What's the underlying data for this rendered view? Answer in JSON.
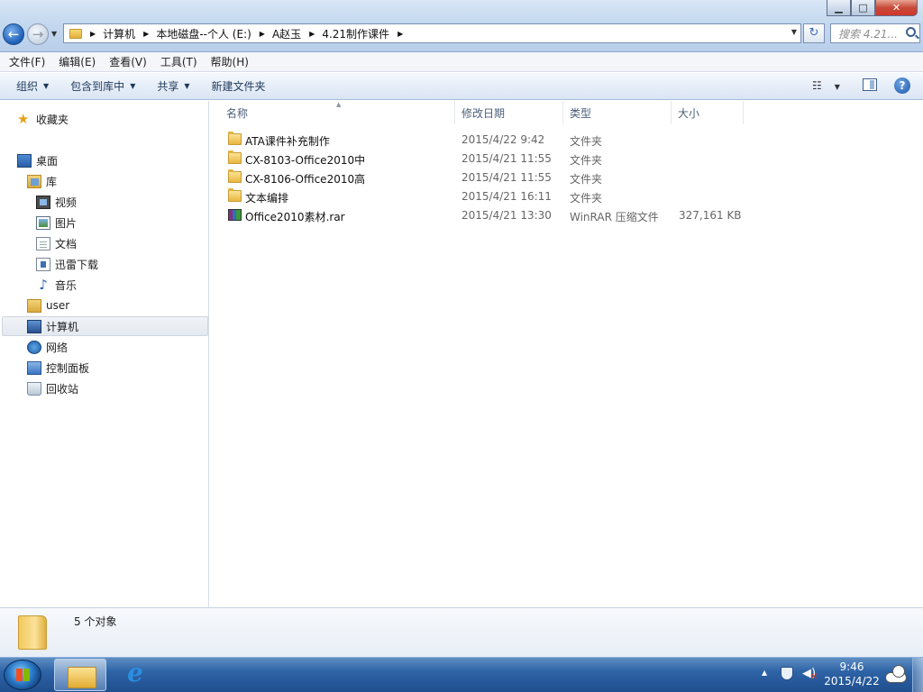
{
  "window": {
    "controls": {
      "minimize": "▁",
      "maximize": "□",
      "close": "✕"
    }
  },
  "nav": {
    "back": "←",
    "forward": "→",
    "refresh": "↻"
  },
  "address": {
    "crumbs": [
      "计算机",
      "本地磁盘--个人 (E:)",
      "A赵玉",
      "4.21制作课件"
    ]
  },
  "search": {
    "placeholder": "搜索 4.21..."
  },
  "menubar": [
    "文件(F)",
    "编辑(E)",
    "查看(V)",
    "工具(T)",
    "帮助(H)"
  ],
  "commandbar": {
    "organize": "组织",
    "include_library": "包含到库中",
    "share": "共享",
    "new_folder": "新建文件夹",
    "views_icon": "☷",
    "help": "?"
  },
  "sidebar": {
    "items": [
      {
        "label": "收藏夹",
        "icon": "star-icon"
      },
      {
        "label": "桌面",
        "icon": "desktop-icon"
      },
      {
        "label": "库",
        "icon": "library-icon"
      },
      {
        "label": "视频",
        "icon": "video-icon"
      },
      {
        "label": "图片",
        "icon": "picture-icon"
      },
      {
        "label": "文档",
        "icon": "document-icon"
      },
      {
        "label": "迅雷下载",
        "icon": "download-icon"
      },
      {
        "label": "音乐",
        "icon": "music-icon"
      },
      {
        "label": "user",
        "icon": "user-folder-icon"
      },
      {
        "label": "计算机",
        "icon": "computer-icon"
      },
      {
        "label": "网络",
        "icon": "network-icon"
      },
      {
        "label": "控制面板",
        "icon": "control-panel-icon"
      },
      {
        "label": "回收站",
        "icon": "recycle-bin-icon"
      }
    ],
    "selected": "计算机"
  },
  "filelist": {
    "columns": [
      "名称",
      "修改日期",
      "类型",
      "大小"
    ],
    "rows": [
      {
        "name": "ATA课件补充制作",
        "date": "2015/4/22 9:42",
        "type": "文件夹",
        "size": "",
        "icon": "folder-icon"
      },
      {
        "name": "CX-8103-Office2010中",
        "date": "2015/4/21 11:55",
        "type": "文件夹",
        "size": "",
        "icon": "folder-icon"
      },
      {
        "name": "CX-8106-Office2010高",
        "date": "2015/4/21 11:55",
        "type": "文件夹",
        "size": "",
        "icon": "folder-icon"
      },
      {
        "name": "文本编排",
        "date": "2015/4/21 16:11",
        "type": "文件夹",
        "size": "",
        "icon": "folder-icon"
      },
      {
        "name": "Office2010素材.rar",
        "date": "2015/4/21 13:30",
        "type": "WinRAR 压缩文件",
        "size": "327,161 KB",
        "icon": "winrar-archive-icon"
      }
    ]
  },
  "details": {
    "status": "5 个对象"
  },
  "taskbar": {
    "tray_arrow": "▲",
    "clock_time": "9:46",
    "clock_date": "2015/4/22"
  },
  "colors": {
    "accent": "#1f4f8f",
    "selection": "#e4e9f0"
  }
}
